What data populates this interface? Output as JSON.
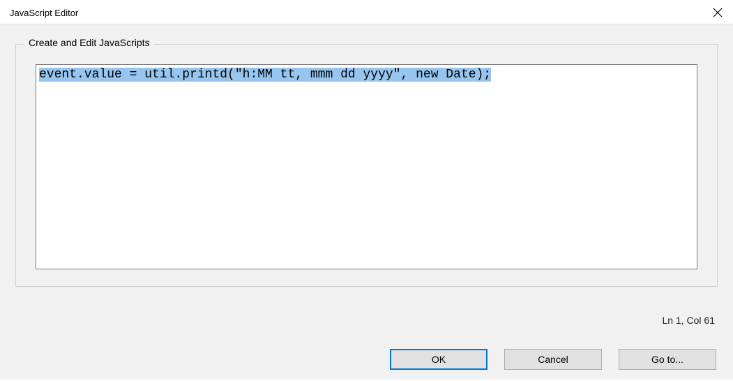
{
  "window": {
    "title": "JavaScript Editor"
  },
  "groupbox": {
    "label": "Create and Edit JavaScripts"
  },
  "editor": {
    "content": "event.value = util.printd(\"h:MM tt, mmm dd yyyy\", new Date);",
    "selected": true
  },
  "status": {
    "position": "Ln 1, Col 61"
  },
  "buttons": {
    "ok": "OK",
    "cancel": "Cancel",
    "goto": "Go to..."
  }
}
